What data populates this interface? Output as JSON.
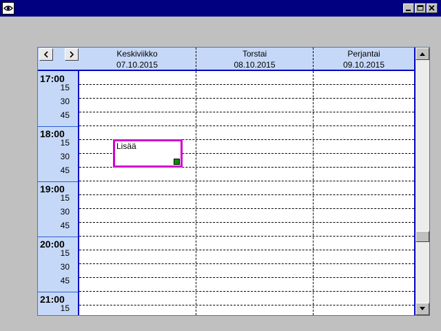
{
  "window": {
    "title": "",
    "icon": "eye-icon"
  },
  "navigation": {
    "prev_icon": "chevron-left-icon",
    "next_icon": "chevron-right-icon"
  },
  "days": [
    {
      "name": "Keskiviikko",
      "date": "07.10.2015"
    },
    {
      "name": "Torstai",
      "date": "08.10.2015"
    },
    {
      "name": "Perjantai",
      "date": "09.10.2015"
    }
  ],
  "hours": [
    {
      "hour": "17:00",
      "quarters": [
        "15",
        "30",
        "45"
      ]
    },
    {
      "hour": "18:00",
      "quarters": [
        "15",
        "30",
        "45"
      ]
    },
    {
      "hour": "19:00",
      "quarters": [
        "15",
        "30",
        "45"
      ]
    },
    {
      "hour": "20:00",
      "quarters": [
        "15",
        "30",
        "45"
      ]
    },
    {
      "hour": "21:00",
      "quarters": [
        "15"
      ]
    }
  ],
  "event": {
    "label": "Lisää",
    "border_color": "#d000d0"
  },
  "colors": {
    "title_bar": "#000080",
    "header_bg": "#c6d8f8",
    "frame": "#0000c0"
  }
}
